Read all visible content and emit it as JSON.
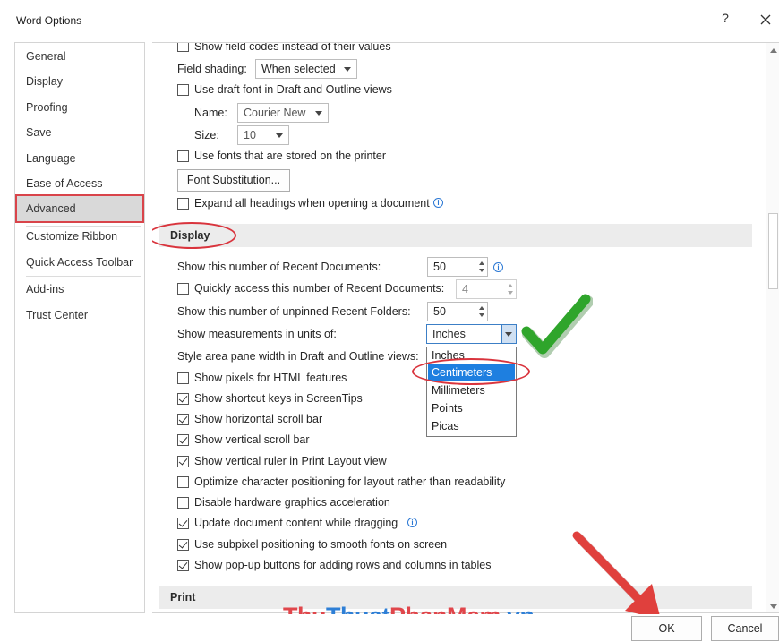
{
  "window": {
    "title": "Word Options",
    "help_label": "?"
  },
  "sidebar": {
    "items": [
      {
        "label": "General"
      },
      {
        "label": "Display"
      },
      {
        "label": "Proofing"
      },
      {
        "label": "Save"
      },
      {
        "label": "Language"
      },
      {
        "label": "Ease of Access"
      },
      {
        "label": "Advanced",
        "active": true
      },
      {
        "label": "Customize Ribbon"
      },
      {
        "label": "Quick Access Toolbar"
      },
      {
        "label": "Add-ins"
      },
      {
        "label": "Trust Center"
      }
    ]
  },
  "top_options": {
    "field_codes_label": "Show field codes instead of their values",
    "field_shading_label": "Field shading:",
    "field_shading_value": "When selected",
    "draft_font_label": "Use draft font in Draft and Outline views",
    "name_label": "Name:",
    "name_value": "Courier New",
    "size_label": "Size:",
    "size_value": "10",
    "printer_fonts_label": "Use fonts that are stored on the printer",
    "font_substitution_label": "Font Substitution...",
    "expand_headings_label": "Expand all headings when opening a document"
  },
  "display_section": {
    "title": "Display",
    "recent_docs_label": "Show this number of Recent Documents:",
    "recent_docs_value": "50",
    "quick_access_label": "Quickly access this number of Recent Documents:",
    "quick_access_value": "4",
    "unpinned_folders_label": "Show this number of unpinned Recent Folders:",
    "unpinned_folders_value": "50",
    "measurement_label": "Show measurements in units of:",
    "measurement_value": "Inches",
    "measurement_options": [
      "Inches",
      "Centimeters",
      "Millimeters",
      "Points",
      "Picas"
    ],
    "measurement_highlighted": "Centimeters",
    "style_area_label": "Style area pane width in Draft and Outline views:",
    "checkboxes": [
      {
        "label": "Show pixels for HTML features",
        "checked": false
      },
      {
        "label": "Show shortcut keys in ScreenTips",
        "checked": true
      },
      {
        "label": "Show horizontal scroll bar",
        "checked": true
      },
      {
        "label": "Show vertical scroll bar",
        "checked": true
      },
      {
        "label": "Show vertical ruler in Print Layout view",
        "checked": true
      },
      {
        "label": "Optimize character positioning for layout rather than readability",
        "checked": false
      },
      {
        "label": "Disable hardware graphics acceleration",
        "checked": false
      },
      {
        "label": "Update document content while dragging",
        "checked": true
      },
      {
        "label": "Use subpixel positioning to smooth fonts on screen",
        "checked": true
      },
      {
        "label": "Show pop-up buttons for adding rows and columns in tables",
        "checked": true
      }
    ]
  },
  "print_section": {
    "title": "Print"
  },
  "footer": {
    "ok_label": "OK",
    "cancel_label": "Cancel"
  },
  "watermark": {
    "part1": "Thu",
    "part2": "Thuat",
    "part3": "PhanMem",
    "part4": ".vn"
  },
  "colors": {
    "accent_red": "#d9343d",
    "selection_blue": "#1e7fe0",
    "check_green": "#2fa52b"
  }
}
